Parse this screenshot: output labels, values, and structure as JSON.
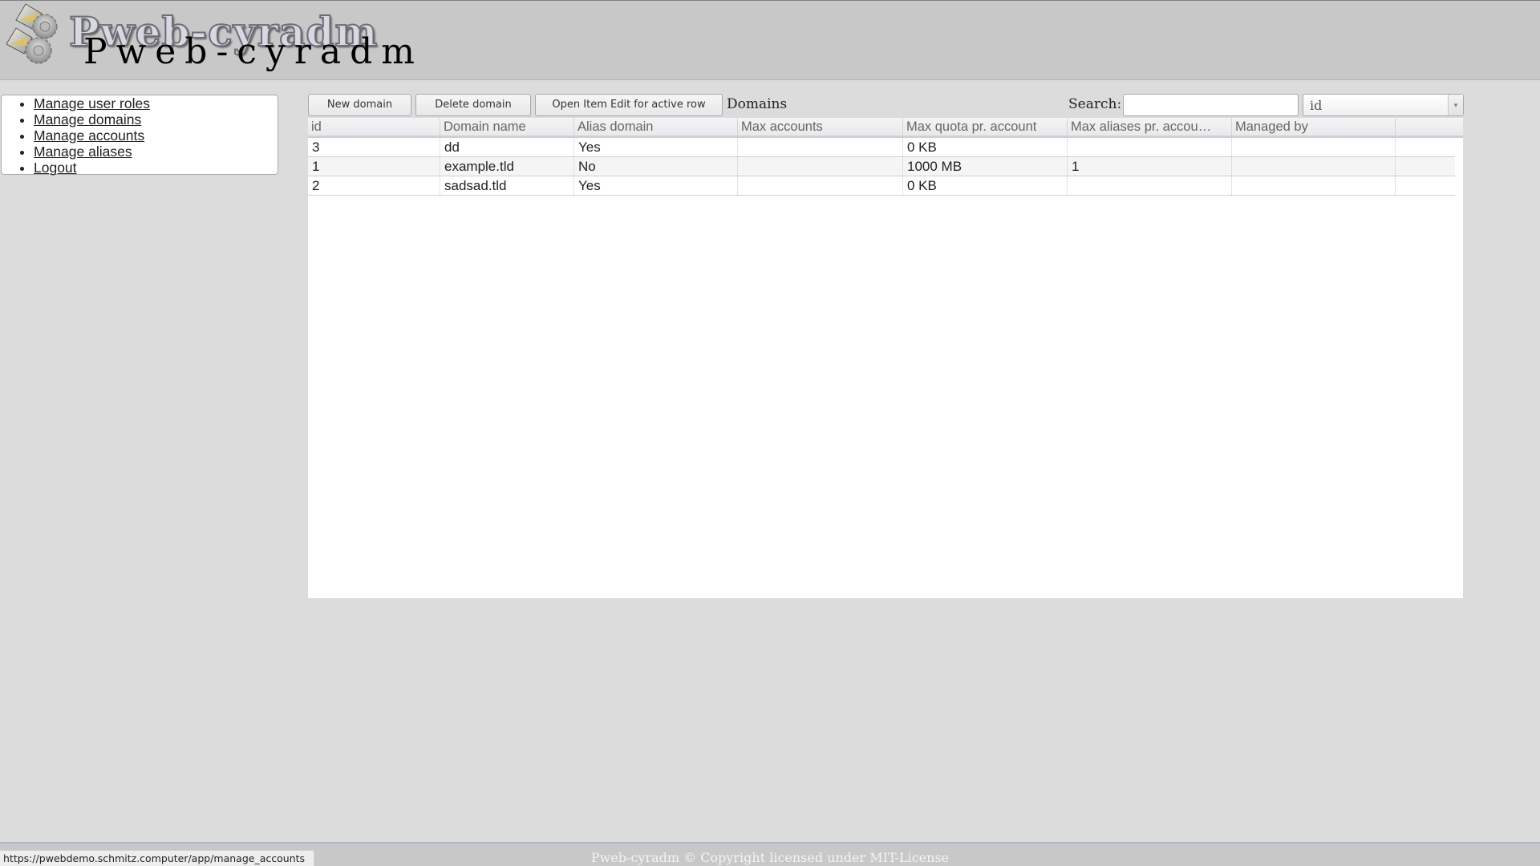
{
  "header": {
    "logo_graphic_text": "Pweb-cyradm",
    "title": "Pweb-cyradm"
  },
  "nav": {
    "items": [
      {
        "label": "Manage user roles"
      },
      {
        "label": "Manage domains"
      },
      {
        "label": "Manage accounts"
      },
      {
        "label": "Manage aliases"
      },
      {
        "label": "Logout"
      }
    ]
  },
  "toolbar": {
    "new_label": "New domain",
    "delete_label": "Delete domain",
    "open_edit_label": "Open Item Edit for active row",
    "grid_title": "Domains",
    "search_label": "Search:",
    "search_value": "",
    "search_field_selected": "id",
    "dropdown_arrow_icon": "▾"
  },
  "grid": {
    "columns": [
      "id",
      "Domain name",
      "Alias domain",
      "Max accounts",
      "Max quota pr. account",
      "Max aliases pr. accou…",
      "Managed by"
    ],
    "rows": [
      [
        "3",
        "dd",
        "Yes",
        "",
        "0 KB",
        "",
        ""
      ],
      [
        "1",
        "example.tld",
        "No",
        "",
        "1000 MB",
        "1",
        ""
      ],
      [
        "2",
        "sadsad.tld",
        "Yes",
        "",
        "0 KB",
        "",
        ""
      ]
    ]
  },
  "footer": {
    "text": "Pweb-cyradm © Copyright licensed under MIT-License"
  },
  "status_bar": {
    "url": "https://pwebdemo.schmitz.computer/app/manage_accounts"
  }
}
